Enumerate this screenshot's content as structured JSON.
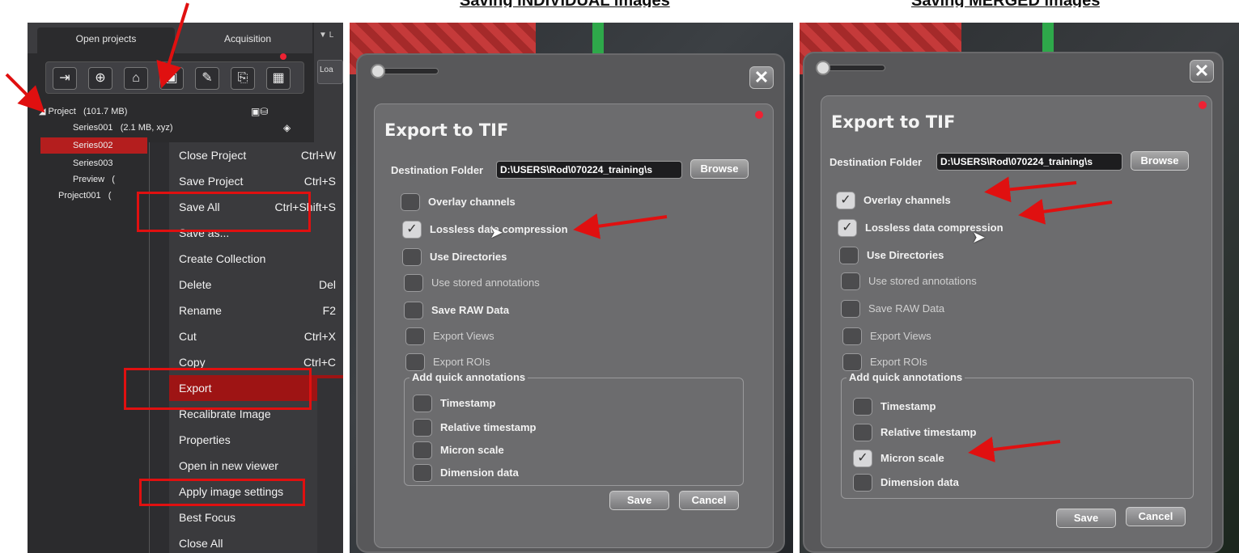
{
  "headings": {
    "individual": "Saving INDIVIDUAL images",
    "merged": "Saving MERGED images"
  },
  "project_panel": {
    "tabs": [
      "Open projects",
      "Acquisition"
    ],
    "side_label": "L",
    "side_button": "Loa",
    "toolbar_icons": [
      "open-project-icon",
      "new-project-icon",
      "open-folder-icon",
      "save-icon",
      "edit-icon",
      "export-icon",
      "grid-icon"
    ],
    "tree": [
      {
        "label": "Project",
        "info": "(101.7 MB)",
        "selected": false
      },
      {
        "label": "Series001",
        "info": "(2.1 MB, xyz)",
        "selected": false
      },
      {
        "label": "Series002",
        "info": "",
        "selected": true
      },
      {
        "label": "Series003",
        "info": "",
        "selected": false
      },
      {
        "label": "Preview",
        "info": "(",
        "selected": false
      },
      {
        "label": "Project001",
        "info": "(",
        "selected": false
      }
    ],
    "context_menu": [
      {
        "label": "Close Project",
        "shortcut": "Ctrl+W"
      },
      {
        "label": "Save Project",
        "shortcut": "Ctrl+S"
      },
      {
        "label": "Save All",
        "shortcut": "Ctrl+Shift+S"
      },
      {
        "label": "Save as...",
        "shortcut": ""
      },
      {
        "label": "Create Collection",
        "shortcut": ""
      },
      {
        "label": "Delete",
        "shortcut": "Del"
      },
      {
        "label": "Rename",
        "shortcut": "F2"
      },
      {
        "label": "Cut",
        "shortcut": "Ctrl+X"
      },
      {
        "label": "Copy",
        "shortcut": "Ctrl+C"
      },
      {
        "label": "Export",
        "shortcut": ""
      },
      {
        "label": "Recalibrate Image",
        "shortcut": ""
      },
      {
        "label": "Properties",
        "shortcut": ""
      },
      {
        "label": "Open in new viewer",
        "shortcut": ""
      },
      {
        "label": "Apply image settings",
        "shortcut": ""
      },
      {
        "label": "Best Focus",
        "shortcut": ""
      },
      {
        "label": "Close All",
        "shortcut": ""
      }
    ]
  },
  "dialog": {
    "title": "Export to TIF",
    "destination_label": "Destination Folder",
    "destination_value": "D:\\USERS\\Rod\\070224_training\\s",
    "browse_label": "Browse",
    "options": [
      "Overlay channels",
      "Lossless data compression",
      "Use Directories",
      "Use stored annotations",
      "Save RAW Data",
      "Export Views",
      "Export ROIs"
    ],
    "annotations_group_label": "Add quick annotations",
    "annotations": [
      "Timestamp",
      "Relative timestamp",
      "Micron scale",
      "Dimension data"
    ],
    "save_label": "Save",
    "cancel_label": "Cancel",
    "checkmark": "✓",
    "individual_state": {
      "options": [
        false,
        true,
        false,
        false,
        false,
        false,
        false
      ],
      "annotations": [
        false,
        false,
        false,
        false
      ]
    },
    "merged_state": {
      "options": [
        true,
        true,
        false,
        false,
        false,
        false,
        false
      ],
      "annotations": [
        false,
        false,
        true,
        false
      ]
    }
  },
  "colors": {
    "highlight_red": "#b41e1e",
    "annotation_red": "#e01010",
    "dark_panel": "#2b2b2d",
    "dialog_gray": "#6c6c6e"
  }
}
